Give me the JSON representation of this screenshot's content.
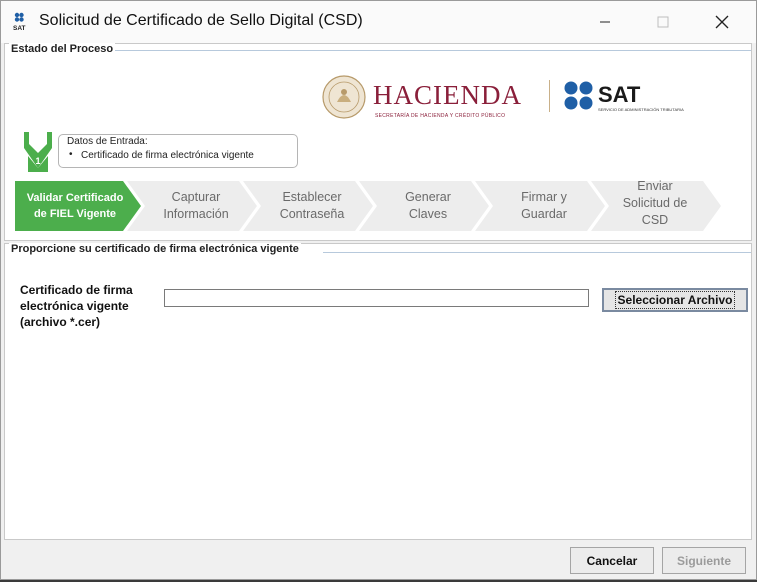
{
  "window": {
    "title": "Solicitud de Certificado de Sello Digital (CSD)",
    "app_icon_text": "SAT"
  },
  "process": {
    "legend": "Estado del Proceso",
    "logos": {
      "hacienda": "HACIENDA",
      "hacienda_sub": "SECRETARÍA DE HACIENDA Y CRÉDITO PÚBLICO",
      "sat": "SAT",
      "sat_sub": "SERVICIO DE ADMINISTRACIÓN TRIBUTARIA"
    },
    "step_number": "1",
    "datos": {
      "title": "Datos de Entrada:",
      "items": [
        "Certificado de firma electrónica vigente"
      ]
    },
    "steps": [
      {
        "label": "Validar Certificado\nde FIEL Vigente",
        "active": true
      },
      {
        "label": "Capturar\nInformación",
        "active": false
      },
      {
        "label": "Establecer\nContraseña",
        "active": false
      },
      {
        "label": "Generar\nClaves",
        "active": false
      },
      {
        "label": "Firmar y\nGuardar",
        "active": false
      },
      {
        "label": "Enviar\nSolicitud de\nCSD",
        "active": false
      }
    ]
  },
  "form": {
    "legend": "Proporcione su certificado de firma electrónica vigente",
    "cert_label": "Certificado de firma\nelectrónica vigente\n(archivo *.cer)",
    "cert_value": "",
    "select_button": "Seleccionar Archivo"
  },
  "footer": {
    "cancel": "Cancelar",
    "next": "Siguiente"
  },
  "colors": {
    "active_step": "#4cae4c",
    "inactive_step": "#ededed",
    "hacienda": "#8a1f3a",
    "sat_blue": "#1f5fa6"
  }
}
